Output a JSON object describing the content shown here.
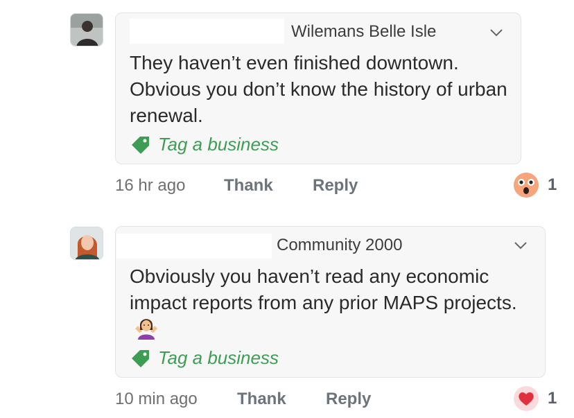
{
  "comments": [
    {
      "author": "Wilemans Belle Isle",
      "text": "They haven’t even finished downtown. Obvious you don’t know the history of urban renewal.",
      "tag_label": "Tag a business",
      "time": "16 hr ago",
      "thank_label": "Thank",
      "reply_label": "Reply",
      "reaction": {
        "icon": "surprised-face-icon",
        "count": "1"
      }
    },
    {
      "author": "Community 2000",
      "text": "Obviously you haven’t read any economic impact reports from any prior MAPS projects.",
      "emoji": "person-shrugging-emoji",
      "tag_label": "Tag a business",
      "time": "10 min ago",
      "thank_label": "Thank",
      "reply_label": "Reply",
      "reaction": {
        "icon": "heart-icon",
        "count": "1"
      }
    }
  ],
  "colors": {
    "tag_green": "#3e9d55",
    "heart_red": "#e0323e",
    "bubble_bg": "#f7f7f7"
  }
}
